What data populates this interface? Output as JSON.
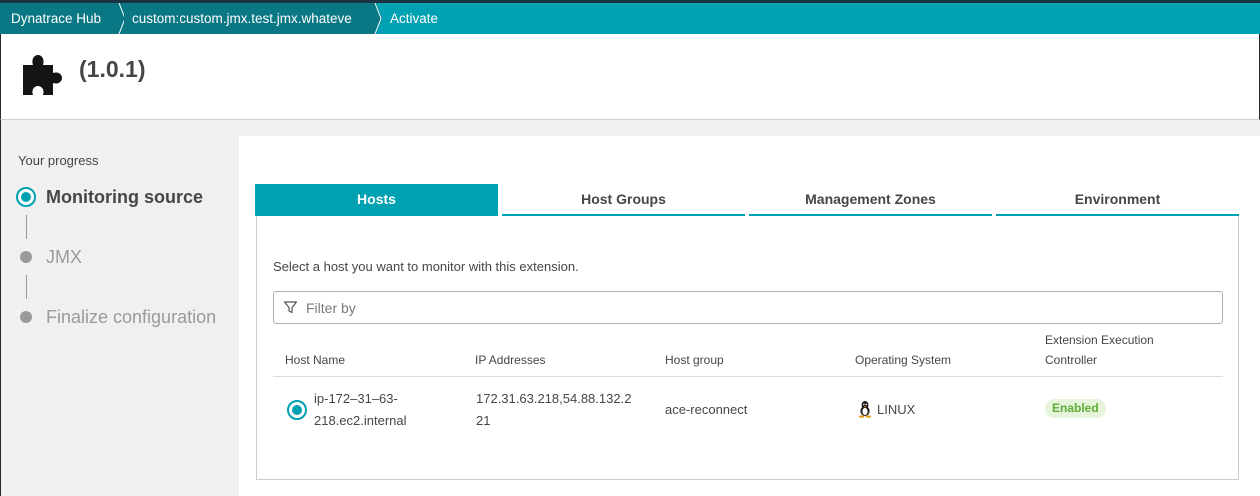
{
  "breadcrumb": {
    "items": [
      "Dynatrace Hub",
      "custom:custom.jmx.test.jmx.whateve",
      "Activate"
    ]
  },
  "header": {
    "icon": "puzzle-icon",
    "version": "(1.0.1)"
  },
  "progress": {
    "title": "Your progress",
    "steps": [
      {
        "label": "Monitoring source",
        "state": "active"
      },
      {
        "label": "JMX",
        "state": "pending"
      },
      {
        "label": "Finalize configuration",
        "state": "pending"
      }
    ]
  },
  "tabs": [
    {
      "label": "Hosts",
      "active": true
    },
    {
      "label": "Host Groups",
      "active": false
    },
    {
      "label": "Management Zones",
      "active": false
    },
    {
      "label": "Environment",
      "active": false
    }
  ],
  "hosts_panel": {
    "instruction": "Select a host you want to monitor with this extension.",
    "filter_placeholder": "Filter by",
    "columns": [
      "Host Name",
      "IP Addresses",
      "Host group",
      "Operating System",
      "Extension Execution Controller"
    ],
    "rows": [
      {
        "host_name_line1": "ip-172–31–63-",
        "host_name_line2": "218.ec2.internal",
        "ip_line1": "172.31.63.218,54.88.132.2",
        "ip_line2": "21",
        "host_group": "ace-reconnect",
        "os": "LINUX",
        "eec_status": "Enabled",
        "selected": true
      }
    ]
  },
  "colors": {
    "accent": "#00a1b2",
    "breadcrumb_dark": "#0a7784",
    "enabled_text": "#5ead35",
    "enabled_bg": "#e6f4dc"
  }
}
